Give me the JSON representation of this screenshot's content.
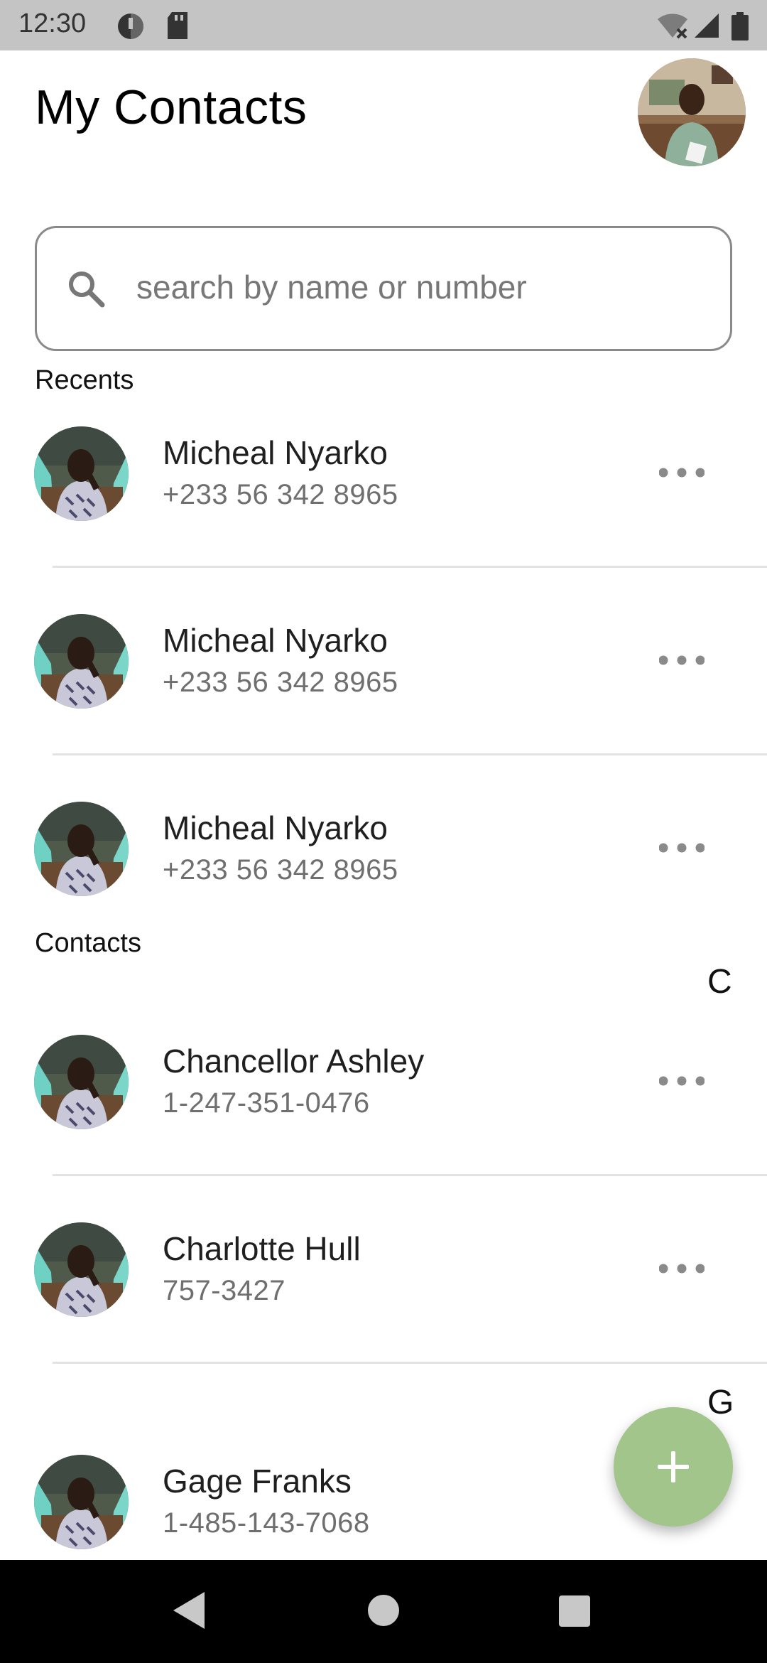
{
  "status_bar": {
    "time": "12:30",
    "icons": [
      "data-saver-icon",
      "sd-card-icon",
      "wifi-off-icon",
      "cell-signal-icon",
      "battery-icon"
    ]
  },
  "header": {
    "title": "My Contacts",
    "avatar_icon": "profile-avatar"
  },
  "search": {
    "placeholder": "search by name or number",
    "value": "",
    "icon": "search-icon"
  },
  "sections": {
    "recents": "Recents",
    "contacts": "Contacts"
  },
  "recents": [
    {
      "name": "Micheal Nyarko",
      "phone": "+233 56 342 8965"
    },
    {
      "name": "Micheal Nyarko",
      "phone": "+233 56 342 8965"
    },
    {
      "name": "Micheal Nyarko",
      "phone": "+233 56 342 8965"
    }
  ],
  "contact_groups": [
    {
      "letter": "C",
      "contacts": [
        {
          "name": "Chancellor Ashley",
          "phone": "1-247-351-0476"
        },
        {
          "name": "Charlotte Hull",
          "phone": "757-3427"
        }
      ]
    },
    {
      "letter": "G",
      "contacts": [
        {
          "name": "Gage Franks",
          "phone": "1-485-143-7068"
        }
      ]
    }
  ],
  "fab": {
    "icon": "plus-icon"
  },
  "nav_bar": {
    "icons": [
      "back-icon",
      "home-icon",
      "recents-icon"
    ]
  },
  "colors": {
    "status_bar_bg": "#c4c4c4",
    "fab": "#a2c58b",
    "divider": "#e3e3e3",
    "phone_text": "#6f6f6f",
    "nav_bar_bg": "#000000"
  }
}
